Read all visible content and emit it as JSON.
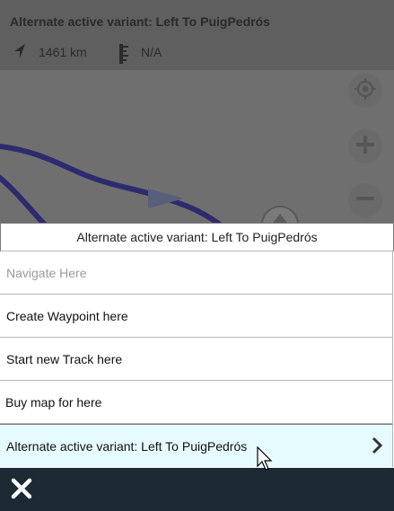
{
  "map": {
    "title": "Alternate active variant: Left To PuigPedrós",
    "distance": "1461 km",
    "elevation": "N/A",
    "icons": [
      "navigation-arrow-icon",
      "ruler-icon",
      "locate-icon",
      "zoom-in-icon",
      "zoom-out-icon"
    ]
  },
  "menu": {
    "header": "Alternate active variant: Left To PuigPedrós",
    "items": [
      {
        "label": "Navigate Here",
        "state": "disabled"
      },
      {
        "label": "Create Waypoint here",
        "state": "normal"
      },
      {
        "label": "Start new Track here",
        "state": "normal"
      },
      {
        "label": "Buy map for here",
        "state": "normal"
      },
      {
        "label": "Alternate active variant: Left To PuigPedrós",
        "state": "selected"
      }
    ]
  },
  "bottombar": {
    "close_icon": "close-icon"
  },
  "colors": {
    "accent_bar": "#1b2a33",
    "selected_row": "#e6fbff",
    "route": "#2e2a6e"
  }
}
